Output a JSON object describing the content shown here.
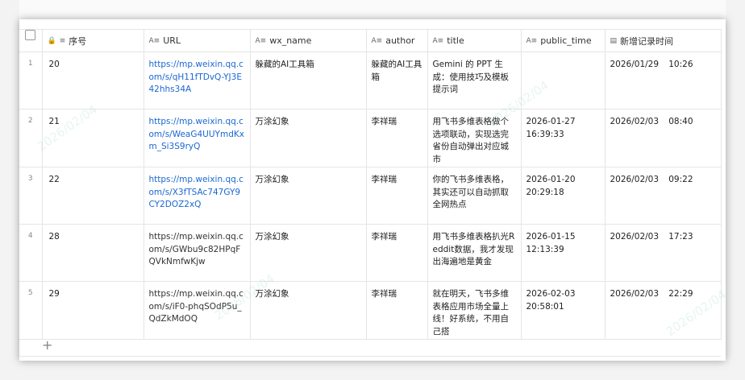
{
  "columns": {
    "url": "URL",
    "wx_name": "wx_name",
    "author": "author",
    "title": "title",
    "public_time": "public_time",
    "created_time": "新增记录时间",
    "seq": "序号"
  },
  "rows": [
    {
      "num": "1",
      "seq": "20",
      "url": "https://mp.weixin.qq.com/s/qH11fTDvQ-YJ3E42hhs34A",
      "url_link": true,
      "wx_name": "躲藏的AI工具箱",
      "author": "躲藏的AI工具箱",
      "title": "Gemini 的 PPT 生成：使用技巧及模板提示词",
      "public_time": "",
      "created_date": "2026/01/29",
      "created_clock": "10:26"
    },
    {
      "num": "2",
      "seq": "21",
      "url": "https://mp.weixin.qq.com/s/WeaG4UUYmdKxm_Si3S9ryQ",
      "url_link": true,
      "wx_name": "万涂幻象",
      "author": "李祥瑞",
      "title": "用飞书多维表格做个选项联动，实现选完省份自动弹出对应城市",
      "public_time": "2026-01-27\n16:39:33",
      "created_date": "2026/02/03",
      "created_clock": "08:40"
    },
    {
      "num": "3",
      "seq": "22",
      "url": "https://mp.weixin.qq.com/s/X3fTSAc747GY9CY2DOZ2xQ",
      "url_link": true,
      "wx_name": "万涂幻象",
      "author": "李祥瑞",
      "title": "你的飞书多维表格，其实还可以自动抓取全网热点",
      "public_time": "2026-01-20\n20:29:18",
      "created_date": "2026/02/03",
      "created_clock": "09:22"
    },
    {
      "num": "4",
      "seq": "28",
      "url": "https://mp.weixin.qq.com/s/GWbu9c82HPqFQVkNmfwKjw",
      "url_link": false,
      "wx_name": "万涂幻象",
      "author": "李祥瑞",
      "title": "用飞书多维表格扒光Reddit数据，我才发现出海遍地是黄金",
      "public_time": "2026-01-15\n12:13:39",
      "created_date": "2026/02/03",
      "created_clock": "17:23"
    },
    {
      "num": "5",
      "seq": "29",
      "url": "https://mp.weixin.qq.com/s/iF0-phqSOdP5u_QdZkMdOQ",
      "url_link": false,
      "wx_name": "万涂幻象",
      "author": "李祥瑞",
      "title": "就在明天，飞书多维表格应用市场全量上线！好系统，不用自己搭",
      "public_time": "2026-02-03\n20:58:01",
      "created_date": "2026/02/03",
      "created_clock": "22:29"
    }
  ],
  "add_row_label": "+",
  "colors": {
    "link": "#1a67d2",
    "border": "#e5e5e5",
    "watermark": "#78c8aa"
  }
}
